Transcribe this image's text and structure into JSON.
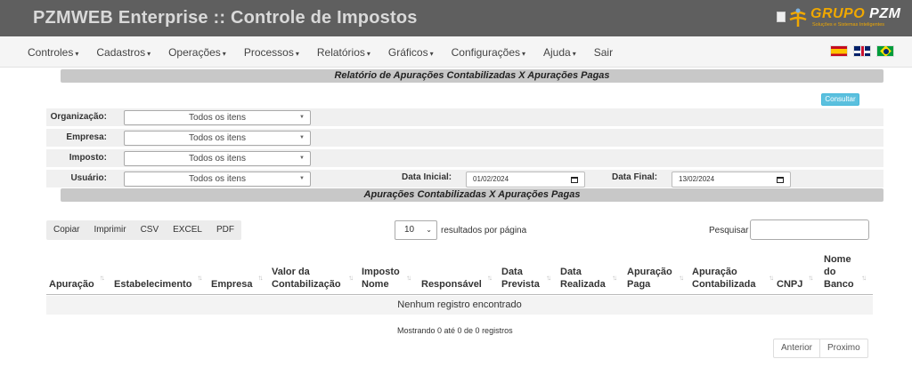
{
  "header": {
    "title": "PZMWEB Enterprise :: Controle de Impostos",
    "logo": {
      "brand": "GRUPO",
      "brand2": "PZM",
      "tagline": "Soluções e Sistemas Inteligentes"
    }
  },
  "menu": {
    "items": [
      {
        "label": "Controles",
        "caret": "▾"
      },
      {
        "label": "Cadastros",
        "caret": "▾"
      },
      {
        "label": "Operações",
        "caret": "▾"
      },
      {
        "label": "Processos",
        "caret": "▾"
      },
      {
        "label": "Relatórios",
        "caret": "▾"
      },
      {
        "label": "Gráficos",
        "caret": "▾"
      },
      {
        "label": "Configurações",
        "caret": "▾"
      },
      {
        "label": "Ajuda",
        "caret": "▾"
      },
      {
        "label": "Sair",
        "caret": ""
      }
    ]
  },
  "report": {
    "title": "Relatório de Apurações Contabilizadas X Apurações Pagas",
    "consult_label": "Consultar"
  },
  "filters": {
    "org_label": "Organização:",
    "org_value": "Todos os itens",
    "empresa_label": "Empresa:",
    "empresa_value": "Todos os itens",
    "imposto_label": "Imposto:",
    "imposto_value": "Todos os itens",
    "usuario_label": "Usuário:",
    "usuario_value": "Todos os itens",
    "data_inicial_label": "Data Inicial:",
    "data_inicial_value": "01/02/2024",
    "data_final_label": "Data Final:",
    "data_final_value": "13/02/2024"
  },
  "results": {
    "title": "Apurações Contabilizadas X Apurações Pagas",
    "buttons": [
      "Copiar",
      "Imprimir",
      "CSV",
      "EXCEL",
      "PDF"
    ],
    "length_value": "10",
    "length_label": "resultados por página",
    "search_label": "Pesquisar",
    "columns": [
      "Apuração",
      "Estabelecimento",
      "Empresa",
      "Valor da Contabilização",
      "Imposto Nome",
      "Responsável",
      "Data Prevista",
      "Data Realizada",
      "Apuração Paga",
      "Apuração Contabilizada",
      "CNPJ",
      "Nome do Banco"
    ],
    "empty_text": "Nenhum registro encontrado",
    "info": "Mostrando 0 até 0 de 0 registros",
    "prev_label": "Anterior",
    "next_label": "Proximo"
  },
  "colors": {
    "header_bg": "#5f5f5f",
    "accent_info": "#5bc0de",
    "logo_orange": "#f0a800"
  }
}
